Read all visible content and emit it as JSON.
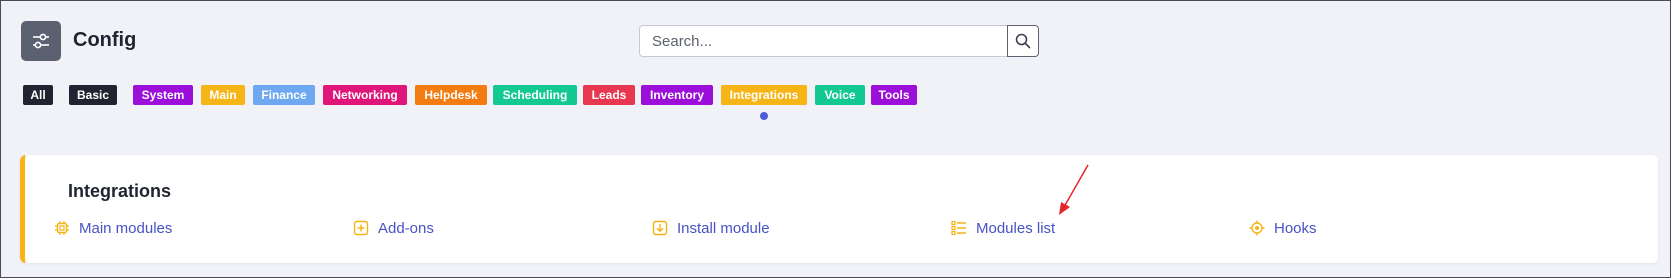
{
  "header": {
    "title": "Config",
    "app_icon": "sliders-icon"
  },
  "search": {
    "placeholder": "Search...",
    "value": "",
    "button_icon": "search-icon"
  },
  "tags": [
    {
      "label": "All",
      "color": "#1f2430"
    },
    {
      "label": "Basic",
      "color": "#1f2430"
    },
    {
      "label": "System",
      "color": "#9b0fd8"
    },
    {
      "label": "Main",
      "color": "#f6b417"
    },
    {
      "label": "Finance",
      "color": "#6ea8f0"
    },
    {
      "label": "Networking",
      "color": "#e0157a"
    },
    {
      "label": "Helpdesk",
      "color": "#f27c12"
    },
    {
      "label": "Scheduling",
      "color": "#14c991"
    },
    {
      "label": "Leads",
      "color": "#e83750"
    },
    {
      "label": "Inventory",
      "color": "#9b0fd8"
    },
    {
      "label": "Integrations",
      "color": "#f6b417"
    },
    {
      "label": "Voice",
      "color": "#14c991"
    },
    {
      "label": "Tools",
      "color": "#9b0fd8"
    }
  ],
  "active_tag": "Integrations",
  "section": {
    "title": "Integrations",
    "accent_color": "#f6b417",
    "links": [
      {
        "label": "Main modules",
        "icon": "chip-icon"
      },
      {
        "label": "Add-ons",
        "icon": "plus-square-icon"
      },
      {
        "label": "Install module",
        "icon": "download-square-icon"
      },
      {
        "label": "Modules list",
        "icon": "list-icon"
      },
      {
        "label": "Hooks",
        "icon": "target-icon"
      }
    ]
  },
  "annotation": {
    "arrow_color": "#e3262b",
    "target": "Modules list"
  }
}
